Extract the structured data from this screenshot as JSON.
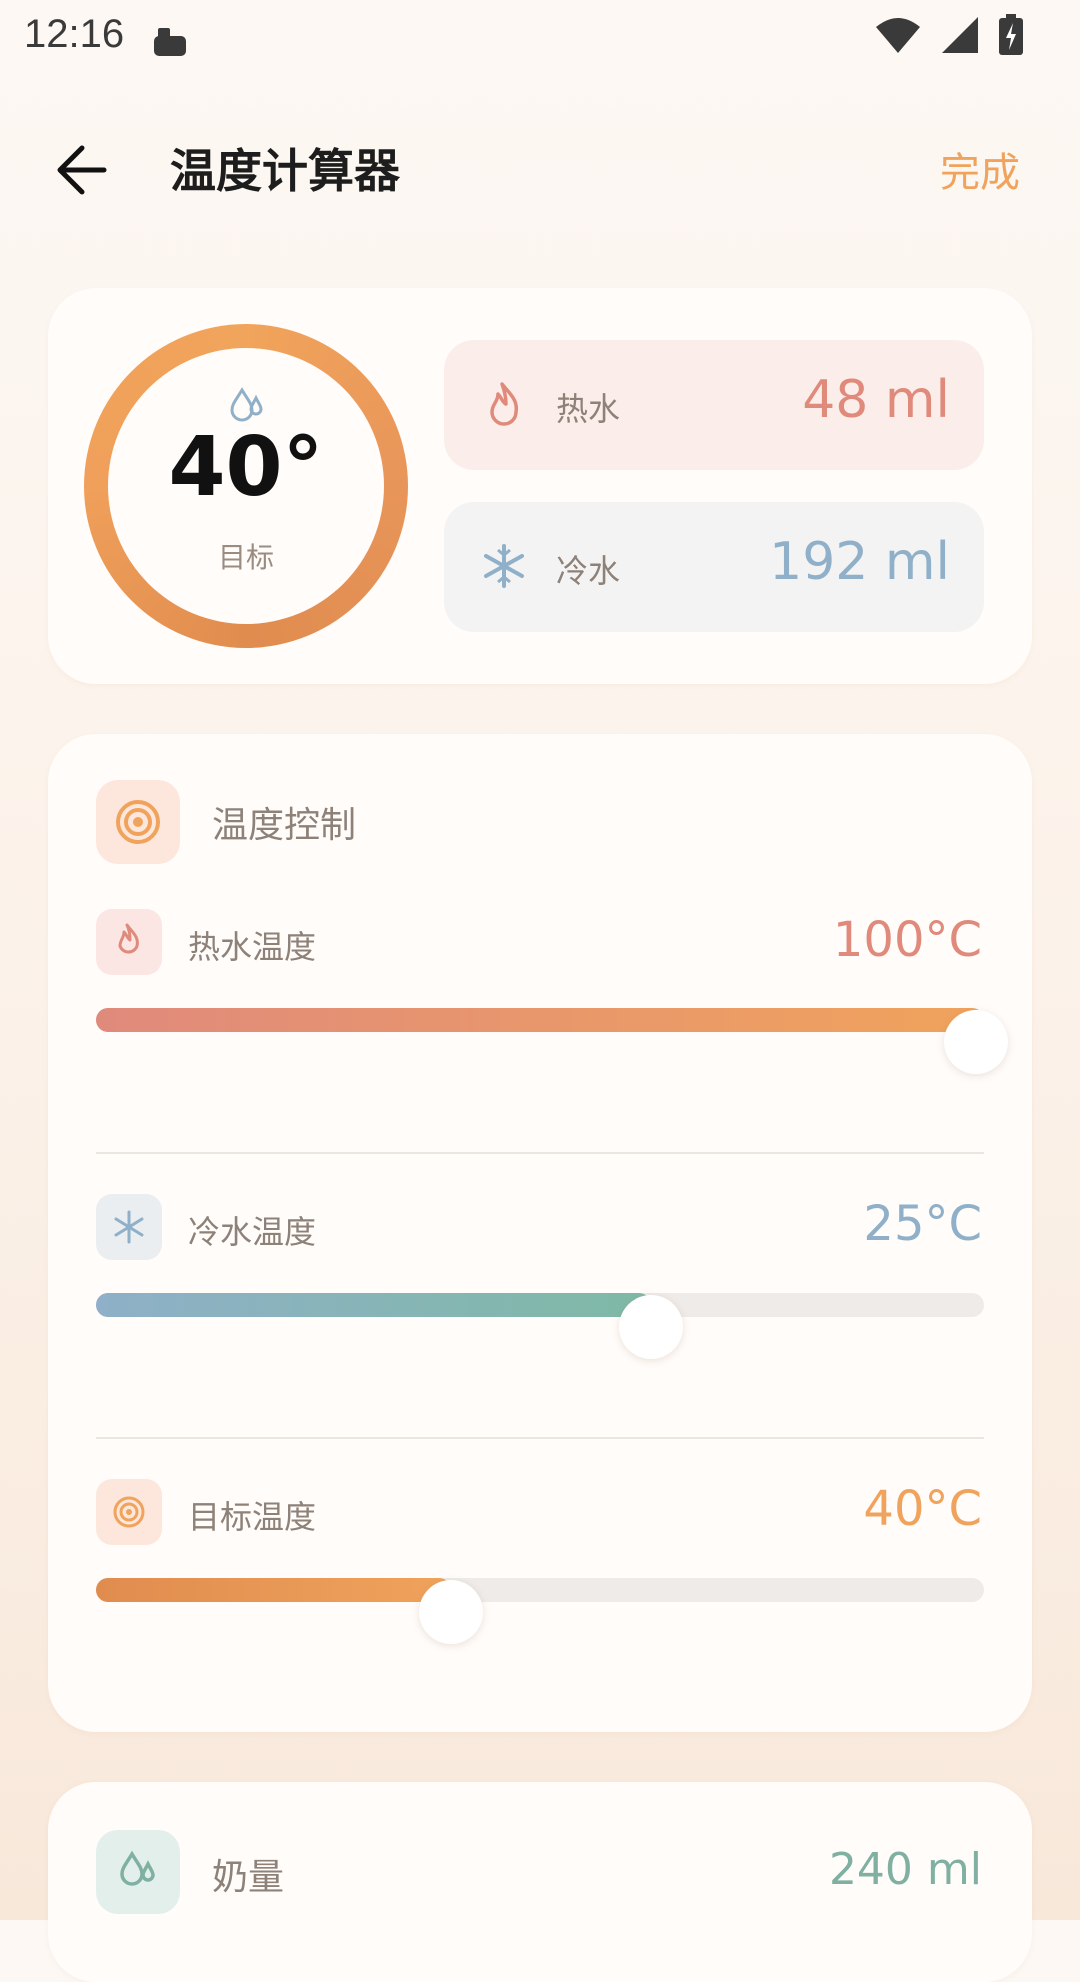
{
  "status": {
    "time": "12:16"
  },
  "header": {
    "title": "温度计算器",
    "done_label": "完成"
  },
  "summary": {
    "target_temp": "40°",
    "target_label": "目标",
    "hot": {
      "label": "热水",
      "value": "48 ml"
    },
    "cold": {
      "label": "冷水",
      "value": "192 ml"
    }
  },
  "control": {
    "title": "温度控制",
    "rows": [
      {
        "label": "热水温度",
        "value": "100°C",
        "level": 1.0
      },
      {
        "label": "冷水温度",
        "value": "25°C",
        "level": 0.625
      },
      {
        "label": "目标温度",
        "value": "40°C",
        "level": 0.4
      }
    ]
  },
  "milk": {
    "label": "奶量",
    "value": "240 ml"
  },
  "colors": {
    "accent": "#f0a35c",
    "hot": "#e08a7c",
    "cold": "#8fb0c8",
    "teal": "#7fb0a2"
  }
}
